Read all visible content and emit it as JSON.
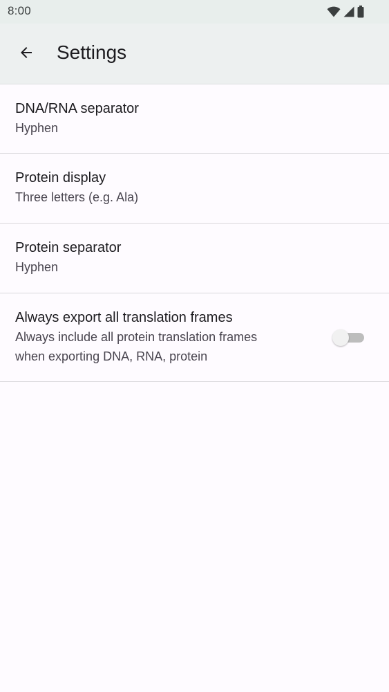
{
  "status_bar": {
    "time": "8:00",
    "icons": [
      "wifi-icon",
      "signal-icon",
      "battery-icon"
    ]
  },
  "app_bar": {
    "back_icon": "arrow-left-icon",
    "title": "Settings"
  },
  "preferences": [
    {
      "title": "DNA/RNA separator",
      "summary": "Hyphen"
    },
    {
      "title": "Protein display",
      "summary": "Three letters (e.g. Ala)"
    },
    {
      "title": "Protein separator",
      "summary": "Hyphen"
    },
    {
      "title": "Always export all translation frames",
      "summary_line1": "Always include all protein translation frames",
      "summary_line2": "when exporting DNA, RNA, protein",
      "switch_on": false
    }
  ],
  "colors": {
    "background": "#fefbff",
    "app_bar": "#edf0f0",
    "status_bar": "#e8eeec",
    "divider": "#d9d7db",
    "switch_track_off": "#bdbdbd",
    "switch_thumb_off": "#f1f1f1"
  }
}
